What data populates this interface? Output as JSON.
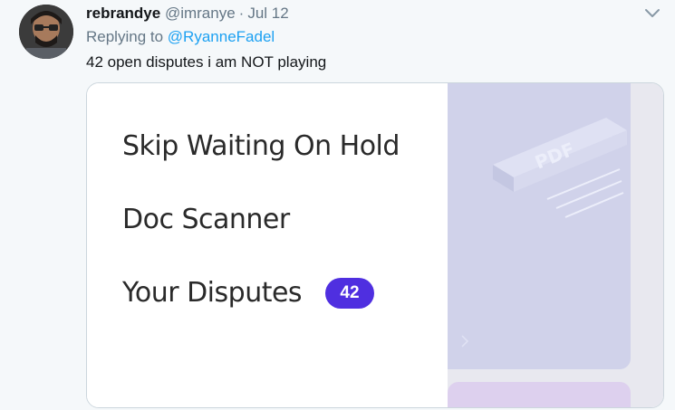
{
  "tweet": {
    "display_name": "rebrandye",
    "handle": "@imranye",
    "separator": "·",
    "date": "Jul 12",
    "replying_prefix": "Replying to",
    "replying_to": "@RyanneFadel",
    "text": "42 open disputes i am NOT playing"
  },
  "card": {
    "menu_items": [
      {
        "label": "Skip Waiting On Hold"
      },
      {
        "label": "Doc Scanner"
      },
      {
        "label": "Your Disputes"
      }
    ],
    "disputes_badge": "42",
    "illustration_label": "PDF"
  },
  "colors": {
    "badge": "#4f2fe0",
    "link": "#1da1f2",
    "muted": "#657786",
    "illustration_panel": "#d0d2ea"
  }
}
